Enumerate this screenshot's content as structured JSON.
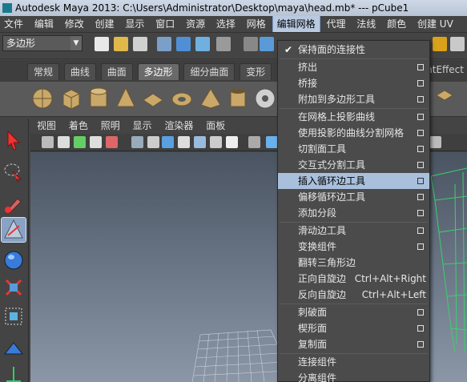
{
  "title_bar": "Autodesk Maya 2013: C:\\Users\\Administrator\\Desktop\\maya\\head.mb*   ---   pCube1",
  "menubar": [
    "文件",
    "编辑",
    "修改",
    "创建",
    "显示",
    "窗口",
    "资源",
    "选择",
    "网格",
    "编辑网格",
    "代理",
    "法线",
    "颜色",
    "创建 UV"
  ],
  "mode_selector": "多边形",
  "shelf_tabs": [
    "常规",
    "曲线",
    "曲面",
    "多边形",
    "细分曲面",
    "变形"
  ],
  "shelf_tab_overflow": "ntEffect",
  "viewport_menu": [
    "视图",
    "着色",
    "照明",
    "显示",
    "渲染器",
    "面板"
  ],
  "dropdown": {
    "checked_item": "保持面的连接性",
    "group1": [
      "挤出",
      "桥接",
      "附加到多边形工具"
    ],
    "group2": [
      "在网格上投影曲线",
      "使用投影的曲线分割网格",
      "切割面工具",
      "交互式分割工具",
      "插入循环边工具",
      "偏移循环边工具",
      "添加分段"
    ],
    "group3": [
      "滑动边工具",
      "变换组件",
      "翻转三角形边"
    ],
    "spin_positive": {
      "label": "正向自旋边",
      "shortcut": "Ctrl+Alt+Right"
    },
    "spin_negative": {
      "label": "反向自旋边",
      "shortcut": "Ctrl+Alt+Left"
    },
    "group4": [
      "刺破面",
      "楔形面",
      "复制面"
    ],
    "group5": [
      "连接组件",
      "分离组件"
    ],
    "highlighted": "插入循环边工具"
  },
  "colors": {
    "menu_highlight": "#a9c0dc",
    "wire_green": "#3bd16b",
    "viewport_top": "#4a5461",
    "viewport_bottom": "#8b96a6"
  }
}
